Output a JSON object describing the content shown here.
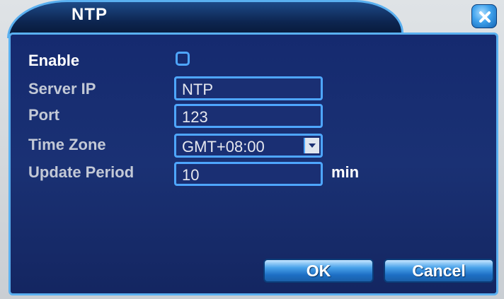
{
  "dialog": {
    "title": "NTP",
    "close_icon": "close-icon"
  },
  "form": {
    "enable": {
      "label": "Enable",
      "checked": false
    },
    "server_ip": {
      "label": "Server IP",
      "value": "NTP"
    },
    "port": {
      "label": "Port",
      "value": "123"
    },
    "time_zone": {
      "label": "Time Zone",
      "value": "GMT+08:00"
    },
    "update_period": {
      "label": "Update Period",
      "value": "10",
      "unit": "min"
    }
  },
  "buttons": {
    "ok": "OK",
    "cancel": "Cancel"
  },
  "colors": {
    "panel_background": "#1a3174",
    "accent_border": "#5ab0f0",
    "field_border": "#4ea6ff",
    "button_blue": "#1d6fc4"
  }
}
